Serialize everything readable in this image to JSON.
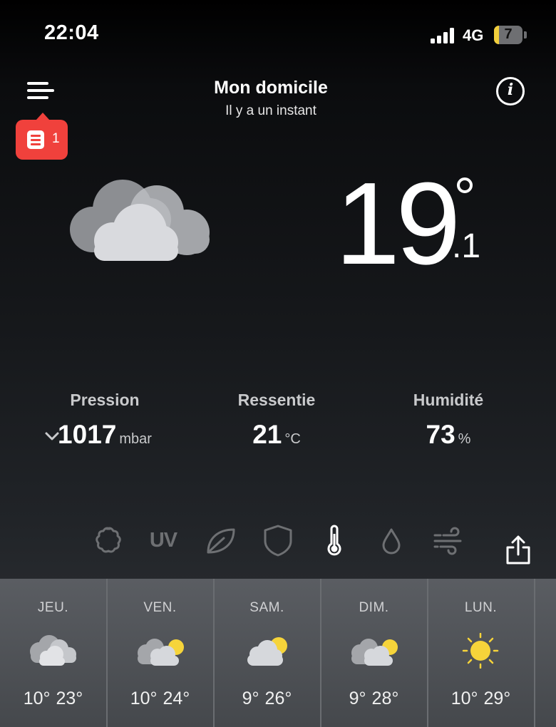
{
  "status_bar": {
    "time": "22:04",
    "network": "4G",
    "battery": "7",
    "battery_color": "#f2cf3c"
  },
  "header": {
    "menu_icon": "hamburger-menu-icon",
    "alert_icon": "document-alert-icon",
    "alert_count": "1",
    "alert_color": "#f0413c",
    "location": "Mon domicile",
    "updated": "Il y a un instant",
    "info_icon": "info-icon"
  },
  "current": {
    "condition_icon": "cloudy-icon",
    "temp_int": "19",
    "temp_dec": ".1"
  },
  "metrics": [
    {
      "label": "Pression",
      "value": "1017",
      "unit": "mbar",
      "trend_icon": "chevron-down-icon"
    },
    {
      "label": "Ressentie",
      "value": "21",
      "unit": "°C"
    },
    {
      "label": "Humidité",
      "value": "73",
      "unit": "%"
    }
  ],
  "layers": {
    "items": [
      "pollen-icon",
      "UV",
      "leaf-icon",
      "shield-icon",
      "thermometer-icon",
      "water-drop-icon",
      "wind-icon"
    ],
    "uv_label": "UV",
    "active": "thermometer-icon",
    "share_icon": "share-icon"
  },
  "forecast": [
    {
      "day": "JEU.",
      "icon": "cloudy-icon",
      "low": "10°",
      "high": "23°"
    },
    {
      "day": "VEN.",
      "icon": "partly-cloudy-icon",
      "low": "10°",
      "high": "24°"
    },
    {
      "day": "SAM.",
      "icon": "partly-cloudy-icon",
      "low": "9°",
      "high": "26°"
    },
    {
      "day": "DIM.",
      "icon": "partly-cloudy-icon",
      "low": "9°",
      "high": "28°"
    },
    {
      "day": "LUN.",
      "icon": "sunny-icon",
      "low": "10°",
      "high": "29°"
    }
  ]
}
